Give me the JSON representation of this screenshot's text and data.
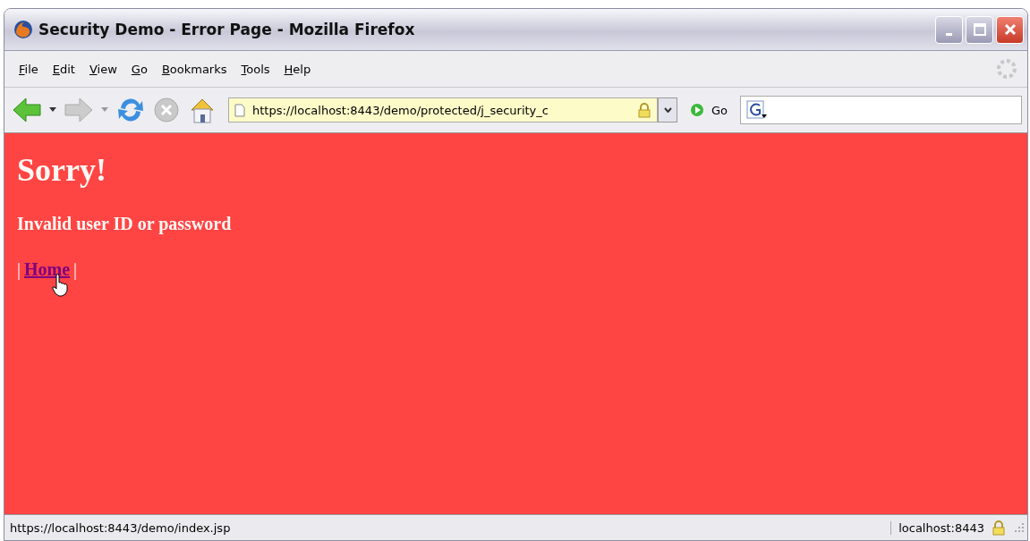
{
  "window": {
    "title": "Security Demo - Error Page - Mozilla Firefox"
  },
  "menu": [
    {
      "label": "File"
    },
    {
      "label": "Edit"
    },
    {
      "label": "View"
    },
    {
      "label": "Go"
    },
    {
      "label": "Bookmarks"
    },
    {
      "label": "Tools"
    },
    {
      "label": "Help"
    }
  ],
  "toolbar": {
    "address": "https://localhost:8443/demo/protected/j_security_c",
    "secure": true,
    "go_label": "Go"
  },
  "page": {
    "heading": "Sorry!",
    "message": "Invalid user ID or password",
    "nav": [
      {
        "kind": "separator",
        "text": "|"
      },
      {
        "kind": "link",
        "text": "Home"
      },
      {
        "kind": "separator",
        "text": "|"
      }
    ]
  },
  "status_bar": {
    "url": "https://localhost:8443/demo/index.jsp",
    "host": "localhost:8443",
    "secure": true
  }
}
